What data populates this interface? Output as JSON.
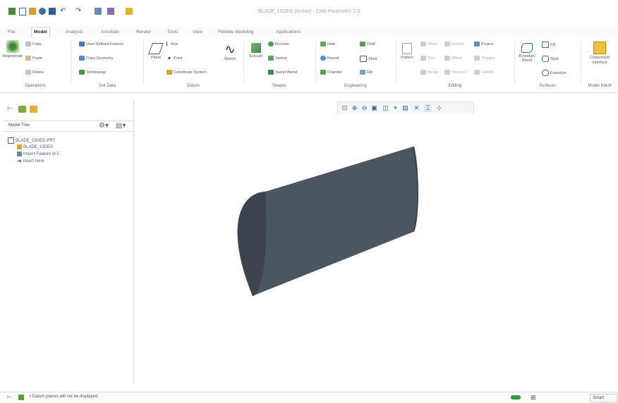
{
  "window": {
    "title": "BLADE_15DEG (Active) - Creo Parametric 2.0"
  },
  "menu": {
    "tabs": [
      "File",
      "Model",
      "Analysis",
      "Annotate",
      "Render",
      "Tools",
      "View",
      "Flexible Modeling",
      "Applications"
    ],
    "active_tab": "Model"
  },
  "ribbon": {
    "operations": {
      "label": "Operations",
      "regenerate": "Regenerate",
      "copy": "Copy",
      "paste": "Paste",
      "delete": "Delete"
    },
    "get_data": {
      "label": "Get Data",
      "udf": "User-Defined Feature",
      "copy_geometry": "Copy Geometry",
      "shrinkwrap": "Shrinkwrap"
    },
    "datum": {
      "label": "Datum",
      "plane": "Plane",
      "axis": "Axis",
      "point": "Point",
      "csys": "Coordinate System",
      "sketch": "Sketch"
    },
    "shapes": {
      "label": "Shapes",
      "extrude": "Extrude",
      "revolve": "Revolve",
      "sweep": "Sweep",
      "swept_blend": "Swept Blend"
    },
    "engineering": {
      "label": "Engineering",
      "hole": "Hole",
      "round": "Round",
      "chamfer": "Chamfer",
      "draft": "Draft",
      "shell": "Shell",
      "rib": "Rib"
    },
    "editing": {
      "label": "Editing",
      "pattern": "Pattern",
      "mirror": "Mirror",
      "extend": "Extend",
      "project": "Project",
      "trim": "Trim",
      "offset": "Offset",
      "thicken": "Thicken",
      "merge": "Merge",
      "intersect": "Intersect",
      "solidify": "Solidify"
    },
    "surfaces": {
      "label": "Surfaces",
      "boundary_blend": "Boundary Blend",
      "fill": "Fill",
      "style": "Style",
      "freestyle": "Freestyle"
    },
    "model_intent": {
      "label": "Model Intent",
      "component_interface": "Component Interface"
    }
  },
  "model_tree": {
    "title": "Model Tree",
    "items": [
      {
        "label": "BLADE_15DEG.PRT",
        "icon": "part-icon"
      },
      {
        "label": "BLADE_15DEG",
        "icon": "datum-icon"
      },
      {
        "label": "Import Feature id 5",
        "icon": "import-icon"
      },
      {
        "label": "Insert Here",
        "icon": "insert-arrow-icon"
      }
    ]
  },
  "status": {
    "message": "Datum planes will not be displayed.",
    "filter": "Smart"
  },
  "colors": {
    "model_dark": "#3f4851",
    "model_mid": "#4e5863",
    "accent": "#2f6fb0",
    "tab_border": "#c9d3dd"
  }
}
